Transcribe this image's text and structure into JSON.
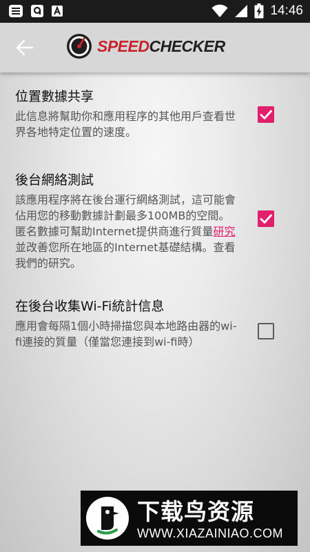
{
  "status_bar": {
    "time": "14:46",
    "icons_left": [
      "notification-list-icon",
      "app-notification-icon",
      "font-notification-icon"
    ],
    "icons_right": [
      "wifi-icon",
      "signal-icon",
      "battery-charging-icon"
    ]
  },
  "app_bar": {
    "back_icon": "arrow-left-icon",
    "logo_speed": "SPEED",
    "logo_checker": "CHECKER"
  },
  "settings": [
    {
      "title": "位置數據共享",
      "description": "此信息將幫助你和應用程序的其他用戶查看世界各地特定位置的速度。",
      "checked": true
    },
    {
      "title": "後台網絡測試",
      "description_before": "該應用程序將在後台運行網絡測試，這可能會佔用您的移動數據計劃最多100MB的空間。 匿名數據可幫助Internet提供商進行質量",
      "description_link": "研究",
      "description_after": "並改善您所在地區的Internet基礎結構。查看我們的研究。",
      "checked": true
    },
    {
      "title": "在後台收集Wi-Fi統計信息",
      "description": "應用會每隔1個小時掃描您與本地路由器的wi-fi連接的質量（僅當您連接到wi-fi時）",
      "checked": false
    }
  ],
  "watermark": {
    "title": "下载鸟资源",
    "url": "WWW.XIAZAINIAO.COM"
  },
  "colors": {
    "accent": "#e0206d",
    "status_bar": "#1b1b1b",
    "app_bar": "#d7d7d7",
    "logo_red": "#c9232b"
  }
}
